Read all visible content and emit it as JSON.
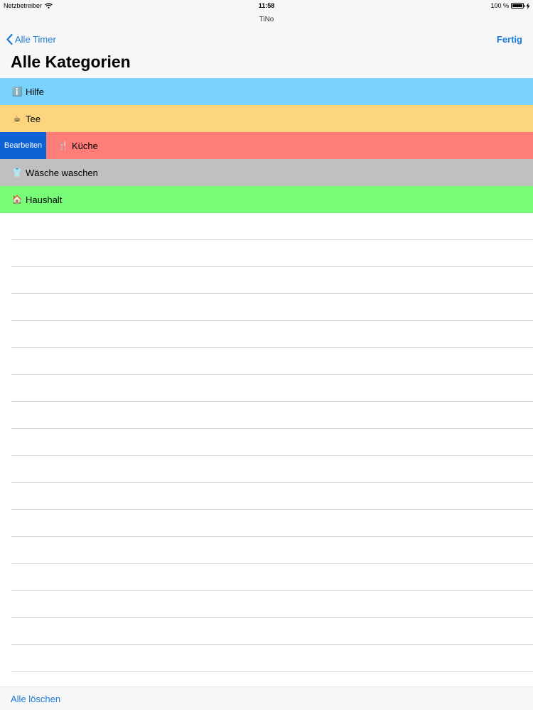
{
  "status_bar": {
    "carrier": "Netzbetreiber",
    "time": "11:58",
    "battery": "100 %",
    "icons": [
      "wifi-icon",
      "battery-icon",
      "charging-icon"
    ]
  },
  "nav": {
    "app_title": "TiNo",
    "back_label": "Alle Timer",
    "done_label": "Fertig",
    "page_title": "Alle Kategorien"
  },
  "categories": [
    {
      "emoji": "ℹ️",
      "name": "Hilfe",
      "color": "#79d3fd"
    },
    {
      "emoji": "☕",
      "name": "Tee",
      "color": "#fdd57f"
    },
    {
      "emoji": "🍴",
      "name": "Küche",
      "color": "#ff7d79",
      "swipe_action": "Bearbeiten"
    },
    {
      "emoji": "👕",
      "name": "Wäsche waschen",
      "color": "#c0c0c0"
    },
    {
      "emoji": "🏠",
      "name": "Haushalt",
      "color": "#79fd79"
    }
  ],
  "footer": {
    "delete_all_label": "Alle löschen"
  },
  "colors": {
    "accent": "#1a7ad6",
    "edit_action": "#0f62d6"
  }
}
